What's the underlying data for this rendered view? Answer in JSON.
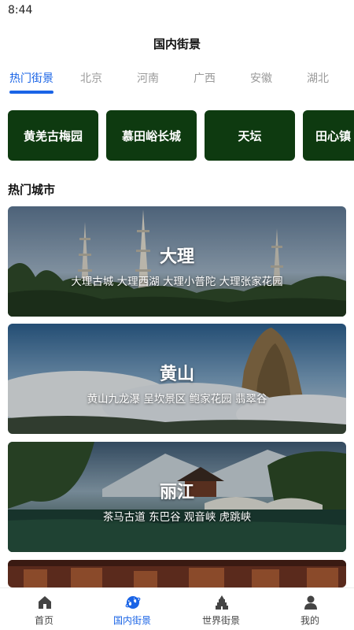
{
  "status_bar": {
    "time": "8:44"
  },
  "header": {
    "title": "国内街景"
  },
  "tabs": [
    {
      "label": "热门街景",
      "active": true
    },
    {
      "label": "北京",
      "active": false
    },
    {
      "label": "河南",
      "active": false
    },
    {
      "label": "广西",
      "active": false
    },
    {
      "label": "安徽",
      "active": false
    },
    {
      "label": "湖北",
      "active": false
    }
  ],
  "hot_spots": [
    {
      "label": "黄羌古梅园"
    },
    {
      "label": "慕田峪长城"
    },
    {
      "label": "天坛"
    },
    {
      "label": "田心镇"
    }
  ],
  "section": {
    "title": "热门城市"
  },
  "cities": [
    {
      "name": "大理",
      "spots": "大理古城  大理西湖  大理小普陀  大理张家花园"
    },
    {
      "name": "黄山",
      "spots": "黄山九龙瀑  呈坎景区  鲍家花园  翡翠谷"
    },
    {
      "name": "丽江",
      "spots": "茶马古道  东巴谷  观音峡  虎跳峡"
    }
  ],
  "bottom_nav": [
    {
      "label": "首页",
      "icon": "home-icon",
      "active": false
    },
    {
      "label": "国内街景",
      "icon": "globe-icon",
      "active": true
    },
    {
      "label": "世界街景",
      "icon": "landmark-icon",
      "active": false
    },
    {
      "label": "我的",
      "icon": "person-icon",
      "active": false
    }
  ],
  "colors": {
    "accent": "#1a64e6",
    "spot_bg": "#0e3a10"
  }
}
